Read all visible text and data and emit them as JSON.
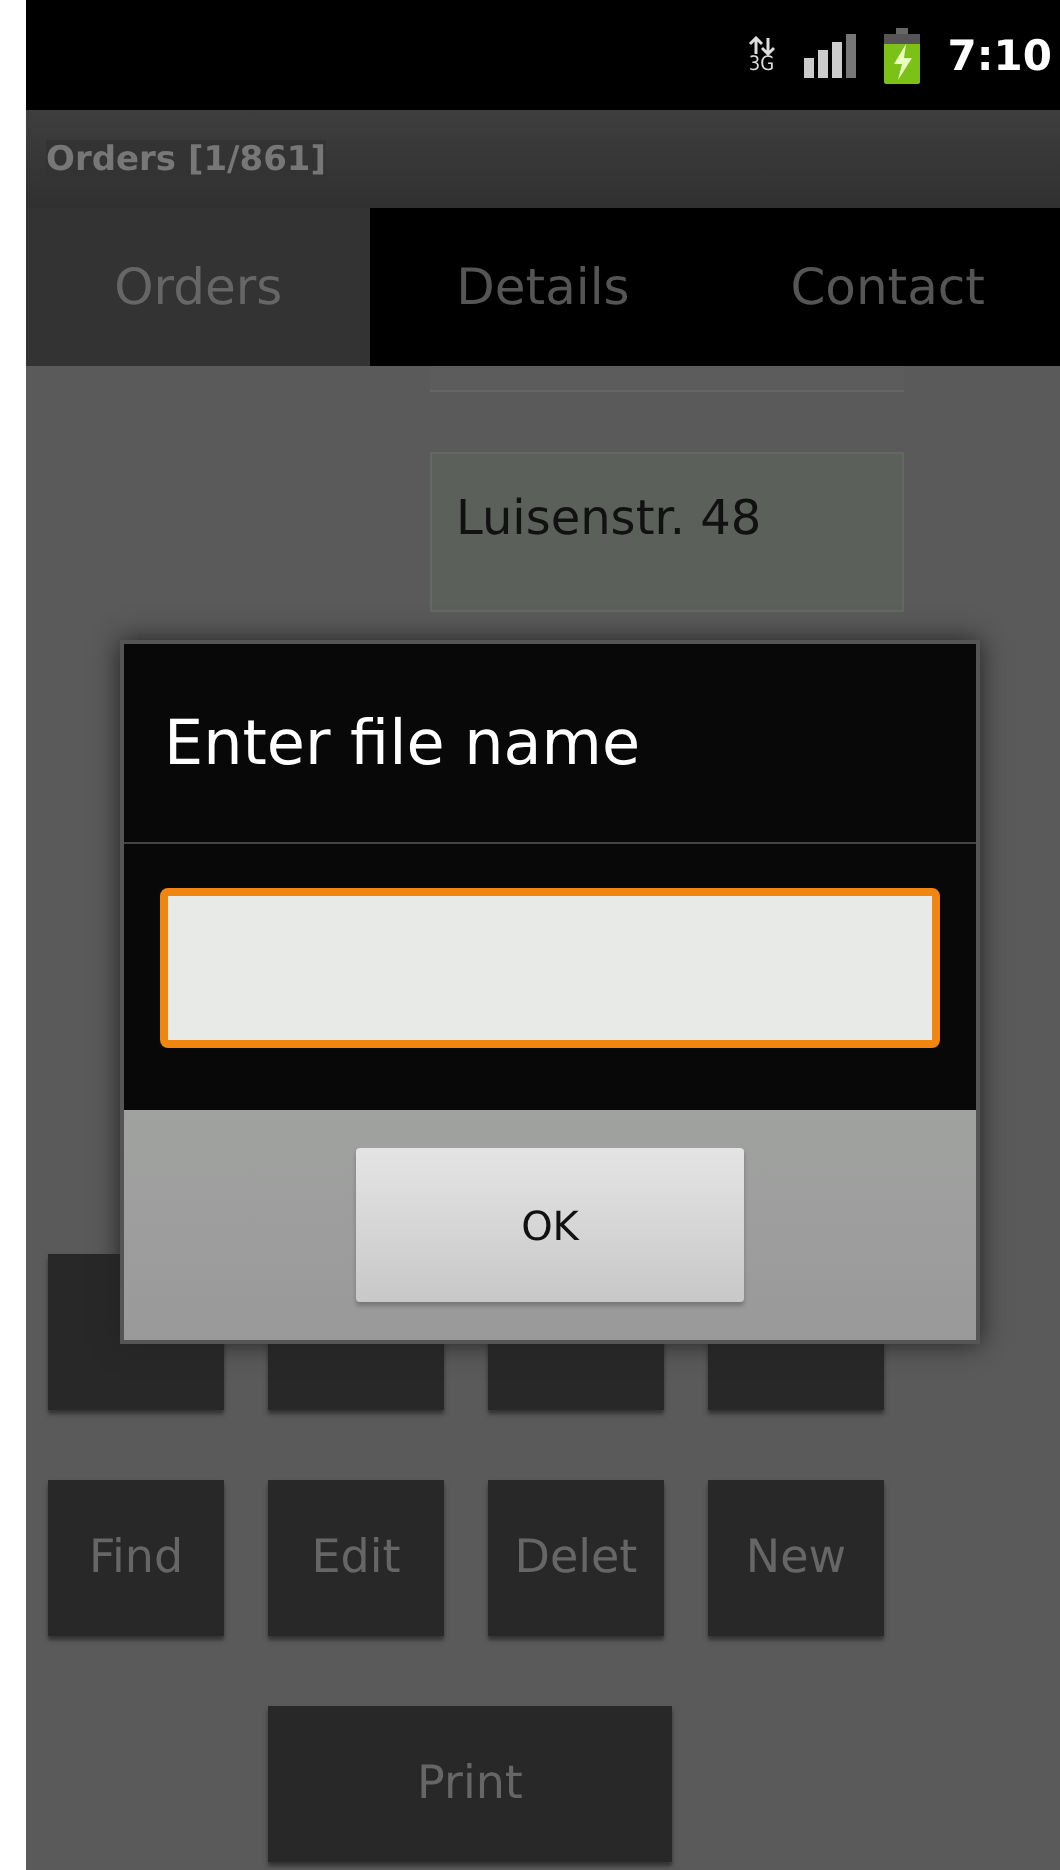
{
  "status_bar": {
    "network": "3G",
    "time": "7:10"
  },
  "title": "Orders [1/861]",
  "tabs": [
    {
      "label": "Orders",
      "selected": true
    },
    {
      "label": "Details",
      "selected": false
    },
    {
      "label": "Contact",
      "selected": false
    }
  ],
  "form": {
    "address": "Luisenstr. 48"
  },
  "button_rows": [
    [
      {
        "kind": "covered"
      },
      {
        "kind": "covered"
      },
      {
        "kind": "covered"
      },
      {
        "kind": "covered"
      }
    ],
    [
      {
        "kind": "labeled",
        "label": "Find"
      },
      {
        "kind": "labeled",
        "label": "Edit"
      },
      {
        "kind": "labeled",
        "label": "Delet"
      },
      {
        "kind": "labeled",
        "label": "New"
      }
    ],
    [
      {
        "kind": "wide",
        "label": "Print"
      }
    ]
  ],
  "dialog": {
    "title": "Enter file name",
    "input": {
      "focused": true
    },
    "buttons": [
      "OK"
    ]
  }
}
